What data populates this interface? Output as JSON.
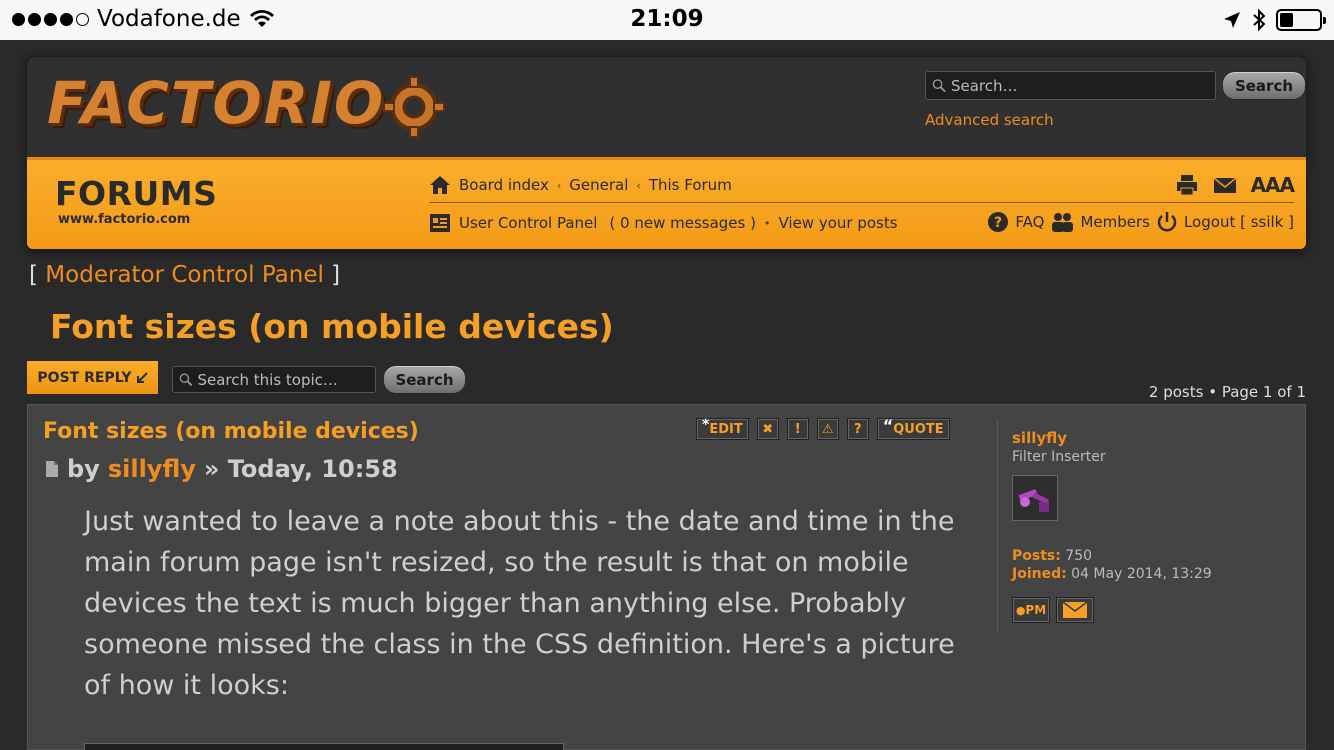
{
  "status_bar": {
    "carrier": "Vodafone.de",
    "time": "21:09",
    "battery_level": 0.35
  },
  "header": {
    "logo_text": "FACTORIO",
    "search_placeholder": "Search…",
    "search_button": "Search",
    "advanced_search": "Advanced search"
  },
  "nav": {
    "forums_title": "FORUMS",
    "forums_url": "www.factorio.com",
    "breadcrumb": [
      "Board index",
      "General",
      "This Forum"
    ],
    "ucp": "User Control Panel",
    "messages": "( 0 new messages )",
    "view_posts": "View your posts",
    "faq": "FAQ",
    "members": "Members",
    "logout": "Logout [ ssilk ]",
    "font_size": "AAA"
  },
  "mcp": {
    "label": "Moderator Control Panel"
  },
  "topic": {
    "title": "Font sizes (on mobile devices)",
    "post_reply": "POST REPLY",
    "search_placeholder": "Search this topic…",
    "search_button": "Search",
    "pagination": "2 posts • Page 1 of 1"
  },
  "post": {
    "subject": "Font sizes (on mobile devices)",
    "by": "by",
    "author": "sillyfly",
    "date": "» Today, 10:58",
    "body": "Just wanted to leave a note about this - the date and time in the main forum page isn't resized, so the result is that on mobile devices the text is much bigger than anything else. Probably someone missed the class in the CSS definition. Here's a picture of how it looks:",
    "buttons": {
      "edit": "EDIT",
      "quote": "QUOTE"
    }
  },
  "profile": {
    "name": "sillyfly",
    "rank": "Filter Inserter",
    "posts_label": "Posts:",
    "posts": "750",
    "joined_label": "Joined:",
    "joined": "04 May 2014, 13:29",
    "pm": "PM"
  }
}
